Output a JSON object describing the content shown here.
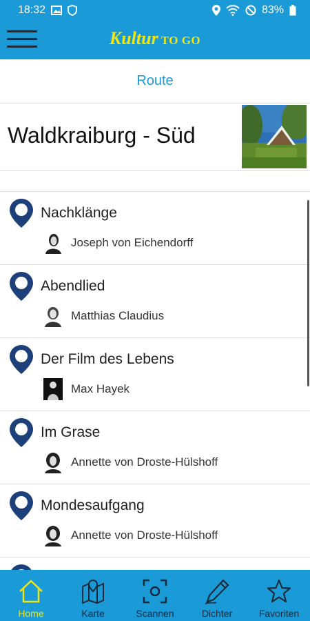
{
  "status": {
    "time": "18:32",
    "battery": "83%"
  },
  "appbar": {
    "logo_main": "Kultur",
    "logo_sub": "TO GO"
  },
  "tabs": {
    "route_label": "Route"
  },
  "route": {
    "title": "Waldkraiburg - Süd"
  },
  "items": [
    {
      "title": "Nachklänge",
      "author": "Joseph von Eichendorff"
    },
    {
      "title": "Abendlied",
      "author": "Matthias Claudius"
    },
    {
      "title": "Der Film des Lebens",
      "author": "Max Hayek"
    },
    {
      "title": "Im Grase",
      "author": "Annette von Droste-Hülshoff"
    },
    {
      "title": "Mondesaufgang",
      "author": "Annette von Droste-Hülshoff"
    }
  ],
  "nav": [
    {
      "label": "Home",
      "icon": "home-icon",
      "active": true
    },
    {
      "label": "Karte",
      "icon": "map-icon"
    },
    {
      "label": "Scannen",
      "icon": "scan-icon"
    },
    {
      "label": "Dichter",
      "icon": "pen-icon"
    },
    {
      "label": "Favoriten",
      "icon": "star-icon"
    }
  ],
  "colors": {
    "primary": "#1a9ad6",
    "accent": "#f2e514",
    "pin": "#1d3f7a"
  }
}
